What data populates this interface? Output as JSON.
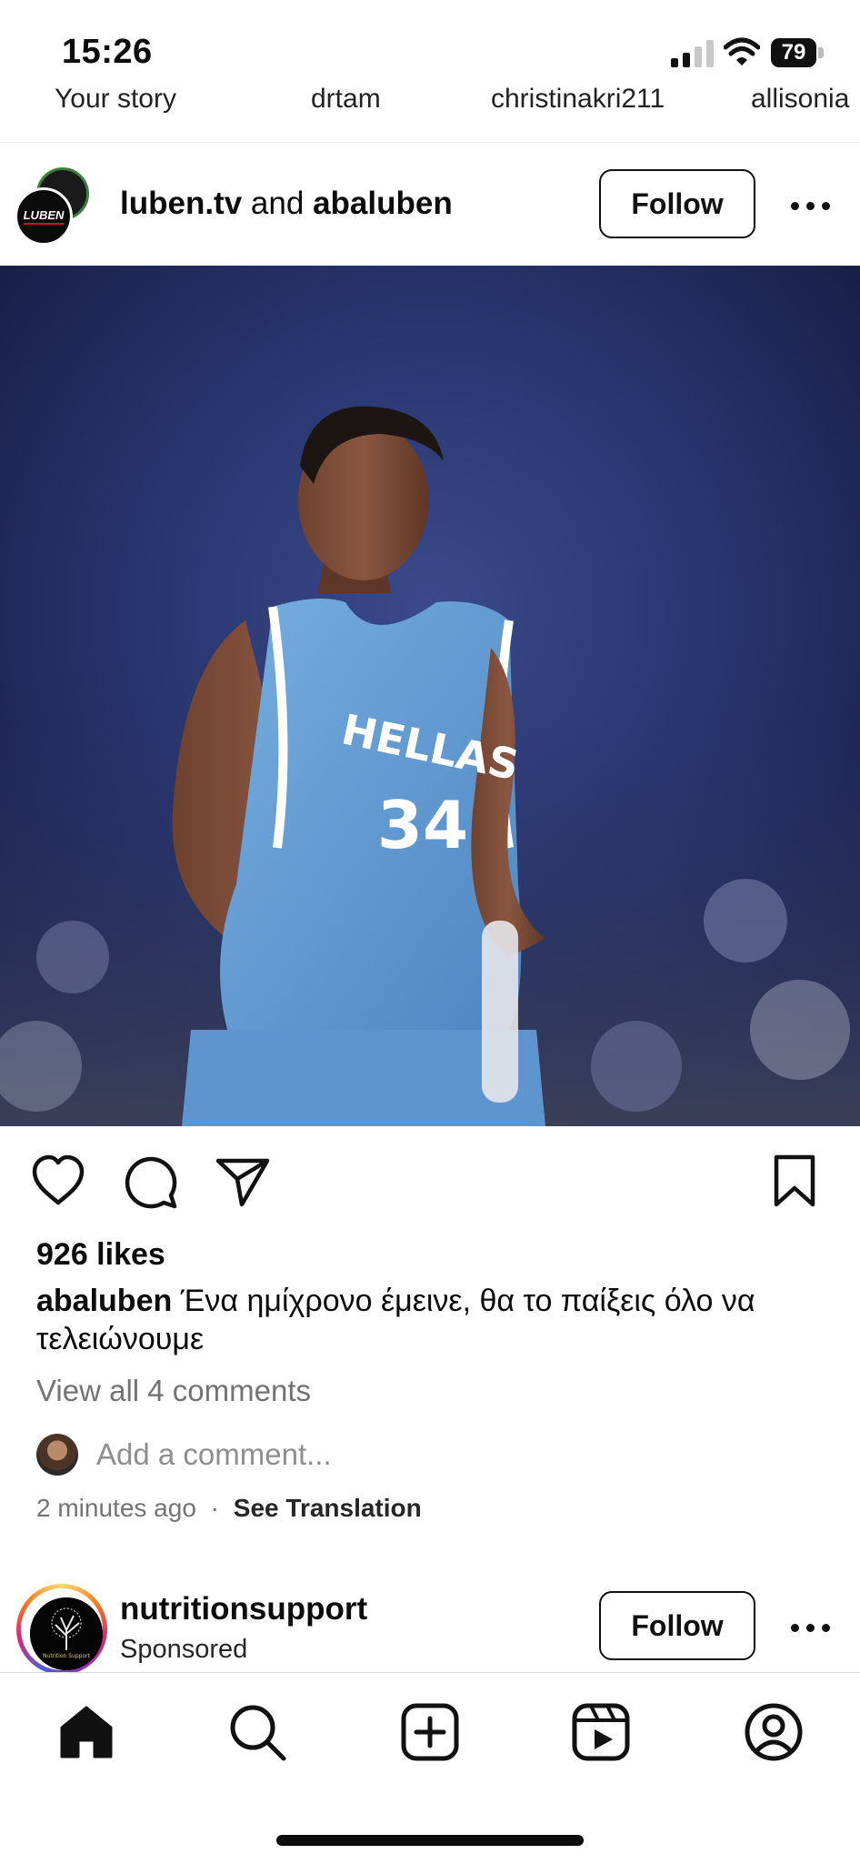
{
  "status_bar": {
    "time": "15:26",
    "battery": "79"
  },
  "stories": [
    "Your story",
    "drtam",
    "christinakri211",
    "allisonia"
  ],
  "post": {
    "avatar_logo_text": "LUBEN",
    "user_primary": "luben.tv",
    "joiner": "and",
    "user_secondary": "abaluben",
    "follow_label": "Follow",
    "image_jersey_text": "HELLAS",
    "image_jersey_number": "34",
    "likes": "926 likes",
    "caption_user": "abaluben",
    "caption_text": "Ένα ημίχρονο έμεινε, θα το παίξεις όλο να τελειώνουμε",
    "view_comments": "View all 4 comments",
    "comment_placeholder": "Add a comment...",
    "time_ago": "2 minutes ago",
    "separator": "·",
    "see_translation": "See Translation"
  },
  "next_post": {
    "username": "nutritionsupport",
    "subtitle": "Sponsored",
    "follow_label": "Follow",
    "avatar_logo_text": "Nutrition Support"
  },
  "icons": {
    "actions": [
      "heart-icon",
      "comment-icon",
      "share-icon",
      "bookmark-icon"
    ],
    "nav": [
      "home-icon",
      "search-icon",
      "create-icon",
      "reels-icon",
      "profile-icon"
    ]
  }
}
